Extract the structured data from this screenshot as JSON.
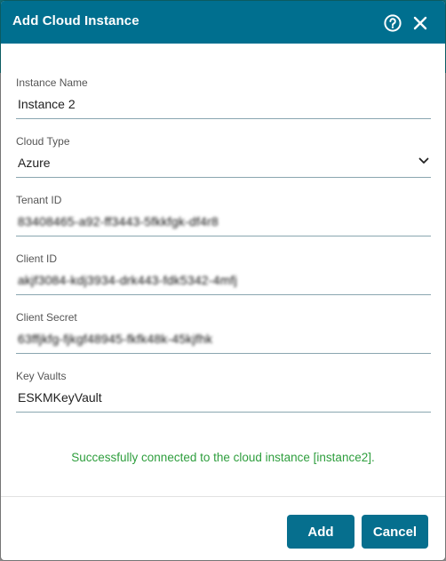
{
  "dialog": {
    "title": "Add Cloud Instance",
    "help_icon": "question-circle-icon",
    "close_icon": "close-icon"
  },
  "fields": {
    "instance_name": {
      "label": "Instance Name",
      "value": "Instance 2"
    },
    "cloud_type": {
      "label": "Cloud Type",
      "value": "Azure",
      "icon": "chevron-down-icon"
    },
    "tenant_id": {
      "label": "Tenant ID",
      "value": "83408465-a92-ff3443-5fkkfgk-df4r8"
    },
    "client_id": {
      "label": "Client ID",
      "value": "akjf3084-kdj3934-drk443-fdk5342-4mfj"
    },
    "client_secret": {
      "label": "Client Secret",
      "value": "63ffjkfg-fjkgf48945-fkfk48k-45kjfhk"
    },
    "key_vaults": {
      "label": "Key Vaults",
      "value": "ESKMKeyVault"
    }
  },
  "status": {
    "message": "Successfully connected to the cloud instance [instance2].",
    "color": "#2e9e3d"
  },
  "buttons": {
    "add_label": "Add",
    "cancel_label": "Cancel"
  },
  "colors": {
    "header": "#006f8f",
    "button": "#066f8e"
  }
}
